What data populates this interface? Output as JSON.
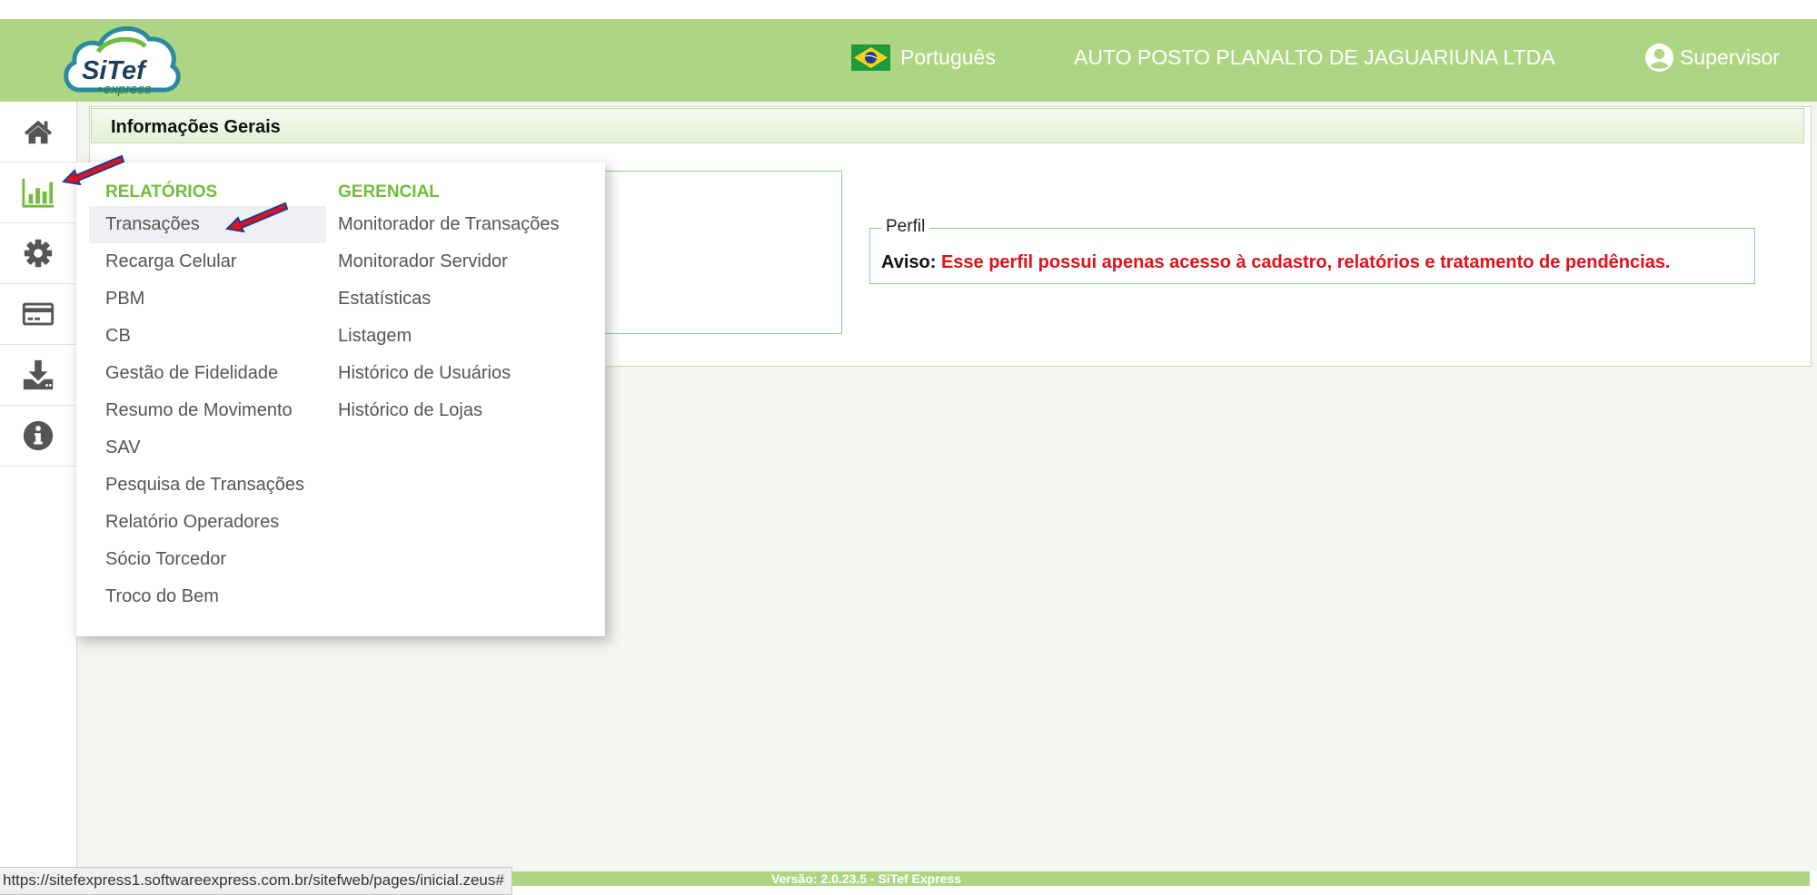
{
  "header": {
    "logo_text": "SiTef",
    "logo_subtext": "express",
    "language": "Português",
    "company": "AUTO POSTO PLANALTO DE JAGUARIUNA LTDA",
    "user": "Supervisor"
  },
  "sidebar": {
    "items": [
      {
        "icon": "home-icon"
      },
      {
        "icon": "bar-chart-icon"
      },
      {
        "icon": "gear-icon"
      },
      {
        "icon": "credit-card-icon"
      },
      {
        "icon": "download-icon"
      },
      {
        "icon": "info-icon"
      }
    ]
  },
  "panel": {
    "title": "Informações Gerais",
    "perfil_legend": "Perfil",
    "aviso_label": "Aviso:",
    "aviso_message": "Esse perfil possui apenas acesso à cadastro, relatórios e tratamento de pendências."
  },
  "menu": {
    "col1": {
      "heading": "RELATÓRIOS",
      "items": [
        "Transações",
        "Recarga Celular",
        "PBM",
        "CB",
        "Gestão de Fidelidade",
        "Resumo de Movimento",
        "SAV",
        "Pesquisa de Transações",
        "Relatório Operadores",
        "Sócio Torcedor",
        "Troco do Bem"
      ]
    },
    "col2": {
      "heading": "GERENCIAL",
      "items": [
        "Monitorador de Transações",
        "Monitorador Servidor",
        "Estatísticas",
        "Listagem",
        "Histórico de Usuários",
        "Histórico de Lojas"
      ]
    }
  },
  "footer": {
    "version": "Versão: 2.0.23.5 - SiTef Express"
  },
  "statusbar": {
    "url": "https://sitefexpress1.softwareexpress.com.br/sitefweb/pages/inicial.zeus#"
  },
  "colors": {
    "header": "#aed584",
    "menu_heading": "#72bd39",
    "warning": "#e2111b",
    "sidebar_icon": "#555555",
    "sidebar_icon_active": "#72bd39"
  }
}
